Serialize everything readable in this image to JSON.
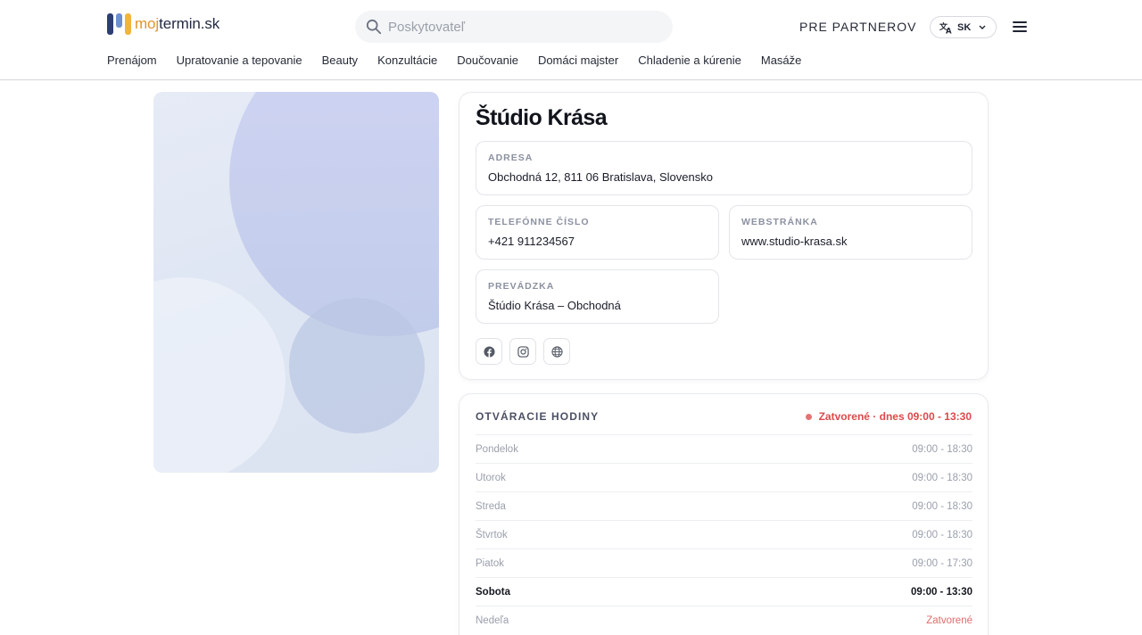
{
  "header": {
    "logo_part1": "moj",
    "logo_part2": "termin.sk",
    "search_placeholder": "Poskytovateľ",
    "partners_label": "PRE PARTNEROV",
    "language": "SK",
    "icons": {
      "search": "search-icon",
      "language": "translate-icon",
      "menu": "hamburger-menu-icon"
    }
  },
  "nav": {
    "items": [
      {
        "label": "Prenájom"
      },
      {
        "label": "Upratovanie a tepovanie"
      },
      {
        "label": "Beauty"
      },
      {
        "label": "Konzultácie"
      },
      {
        "label": "Doučovanie"
      },
      {
        "label": "Domáci majster"
      },
      {
        "label": "Chladenie a kúrenie"
      },
      {
        "label": "Masáže"
      }
    ]
  },
  "provider": {
    "name": "Štúdio Krása",
    "address": {
      "label": "ADRESA",
      "value": "Obchodná 12, 811 06 Bratislava, Slovensko"
    },
    "phone": {
      "label": "TELEFÓNNE ČÍSLO",
      "value": "+421 911234567"
    },
    "website": {
      "label": "WEBSTRÁNKA",
      "value": "www.studio-krasa.sk"
    },
    "shop": {
      "label": "PREVÁDZKA",
      "value": "Štúdio Krása – Obchodná"
    },
    "socials": [
      "facebook-icon",
      "instagram-icon",
      "globe-icon"
    ]
  },
  "hours": {
    "title": "OTVÁRACIE HODINY",
    "status": "Zatvorené · dnes 09:00 - 13:30",
    "status_color": "#dc4a4a",
    "days": [
      {
        "day": "Pondelok",
        "time": "09:00 - 18:30"
      },
      {
        "day": "Utorok",
        "time": "09:00 - 18:30"
      },
      {
        "day": "Streda",
        "time": "09:00 - 18:30"
      },
      {
        "day": "Štvrtok",
        "time": "09:00 - 18:30"
      },
      {
        "day": "Piatok",
        "time": "09:00 - 17:30"
      },
      {
        "day": "Sobota",
        "time": "09:00 - 13:30"
      },
      {
        "day": "Nedeľa",
        "time": "Zatvorené"
      }
    ]
  }
}
